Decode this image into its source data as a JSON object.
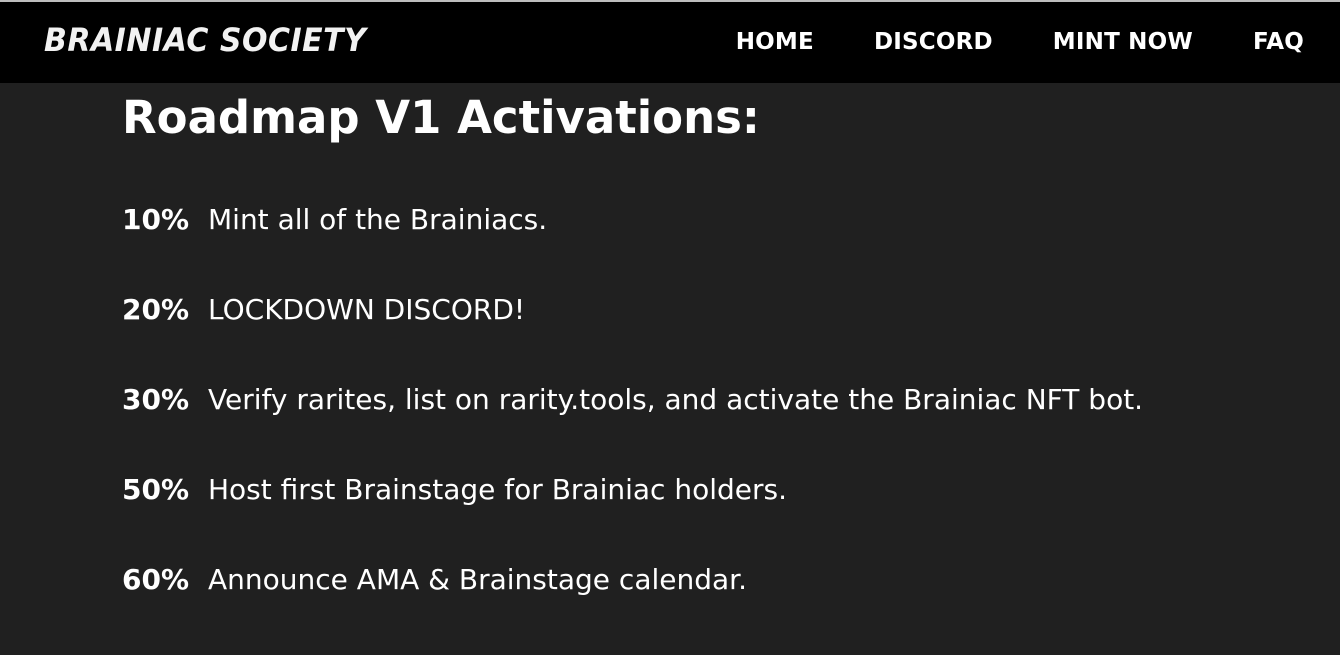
{
  "nav": {
    "brand": "BRAINIAC SOCIETY",
    "links": [
      "HOME",
      "DISCORD",
      "MINT NOW",
      "FAQ"
    ]
  },
  "roadmap": {
    "title": "Roadmap V1 Activations:",
    "items": [
      {
        "percent": "10%",
        "text": "Mint all of the Brainiacs."
      },
      {
        "percent": "20%",
        "text": "LOCKDOWN DISCORD!"
      },
      {
        "percent": "30%",
        "text": "Verify rarites, list on rarity.tools, and activate the Brainiac NFT bot."
      },
      {
        "percent": "50%",
        "text": "Host first Brainstage for Brainiac holders."
      },
      {
        "percent": "60%",
        "text": "Announce AMA & Brainstage calendar."
      }
    ]
  },
  "colors": {
    "navbar_bg": "#000000",
    "page_bg": "#202020",
    "text": "#ffffff"
  }
}
